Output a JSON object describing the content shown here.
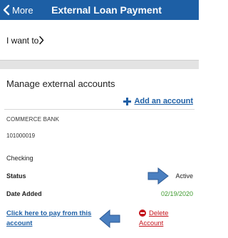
{
  "header": {
    "back_label": "More",
    "title": "External Loan Payment",
    "background": "#1d5fa5"
  },
  "want_to": {
    "label": "I want to"
  },
  "manage": {
    "title": "Manage external accounts",
    "add_label": "Add an account",
    "account": {
      "bank_name": "COMMERCE BANK",
      "routing_number": "101000019",
      "type": "Checking",
      "status_label": "Status",
      "status_value": "Active",
      "date_added_label": "Date Added",
      "date_added_value": "02/19/2020",
      "pay_link": "Click here to pay from this account",
      "delete_label_line1": "Delete",
      "delete_label_line2": "Account"
    }
  },
  "colors": {
    "link_blue": "#1d5fa5",
    "delete_red": "#c4141c",
    "date_green": "#3e9a2e",
    "arrow_blue": "#4a7fc0"
  },
  "icons": [
    "chevron-left-icon",
    "chevron-right-icon",
    "plus-icon",
    "minus-circle-icon",
    "arrow-right-icon",
    "arrow-left-icon"
  ]
}
